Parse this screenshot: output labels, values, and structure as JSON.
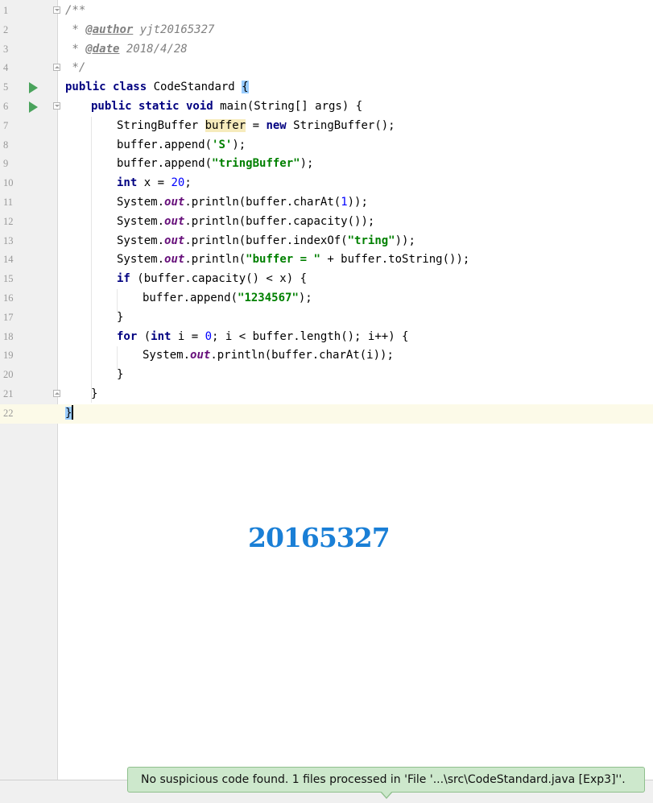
{
  "editor": {
    "line_numbers": [
      "1",
      "2",
      "3",
      "4",
      "5",
      "6",
      "7",
      "8",
      "9",
      "10",
      "11",
      "12",
      "13",
      "14",
      "15",
      "16",
      "17",
      "18",
      "19",
      "20",
      "21",
      "22"
    ],
    "lines": {
      "l1": "/**",
      "l2a": " * ",
      "l2_tag": "@author",
      "l2_val": " yjt20165327",
      "l3a": " * ",
      "l3_tag": "@date",
      "l3_val": " 2018/4/28",
      "l4": " */",
      "l5_kw": "public class",
      "l5_name": " CodeStandard ",
      "l5_brace": "{",
      "l6_kw": "public static void",
      "l6_rest": " main(String[] args) {",
      "l7_a": "StringBuffer ",
      "l7_var": "buffer",
      "l7_b": " = ",
      "l7_kw": "new",
      "l7_c": " StringBuffer();",
      "l8_a": "buffer.append(",
      "l8_str": "'S'",
      "l8_b": ");",
      "l9_a": "buffer.append(",
      "l9_str": "\"tringBuffer\"",
      "l9_b": ");",
      "l10_kw": "int",
      "l10_a": " x = ",
      "l10_num": "20",
      "l10_b": ";",
      "sys": "System.",
      "out": "out",
      "l11_a": ".println(buffer.charAt(",
      "l11_num": "1",
      "l11_b": "));",
      "l12_a": ".println(buffer.capacity());",
      "l13_a": ".println(buffer.indexOf(",
      "l13_str": "\"tring\"",
      "l13_b": "));",
      "l14_a": ".println(",
      "l14_str": "\"buffer = \"",
      "l14_b": " + buffer.toString());",
      "l15_kw": "if",
      "l15_a": " (buffer.capacity() < x) {",
      "l16_a": "buffer.append(",
      "l16_str": "\"1234567\"",
      "l16_b": ");",
      "l17": "}",
      "l18_kw": "for",
      "l18_a": " (",
      "l18_kw2": "int",
      "l18_b": " i = ",
      "l18_num": "0",
      "l18_c": "; i < buffer.length(); i++) {",
      "l19_a": ".println(buffer.charAt(i));",
      "l20": "}",
      "l21": "}",
      "l22": "}"
    }
  },
  "watermark": "20165327",
  "notification": {
    "message": "No suspicious code found. 1 files processed in 'File '...\\src\\CodeStandard.java [Exp3]''."
  },
  "colors": {
    "keyword": "#000080",
    "string": "#008000",
    "number": "#0000ff",
    "comment": "#808080",
    "static_field": "#660e7a",
    "run_icon": "#4aa35c",
    "watermark": "#1a7fd6",
    "notification_bg": "#cde8cc"
  }
}
